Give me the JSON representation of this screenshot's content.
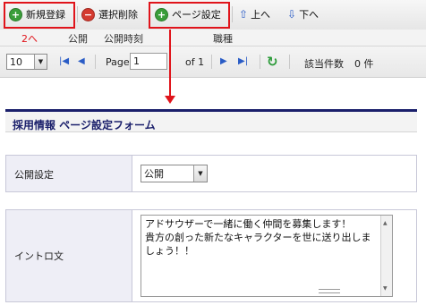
{
  "toolbar": {
    "new_label": "新規登録",
    "delete_label": "選択削除",
    "page_settings_label": "ページ設定",
    "up_label": "上へ",
    "down_label": "下へ"
  },
  "columns": {
    "annotation": "2へ",
    "public": "公開",
    "publish_time": "公開時刻",
    "job_type": "職種"
  },
  "pager": {
    "page_size": "10",
    "page_label": "Page",
    "page_value": "1",
    "of_label": "of 1",
    "count_label": "該当件数",
    "count_value": "0 件"
  },
  "form": {
    "title": "採用情報  ページ設定フォーム",
    "publish_setting_label": "公開設定",
    "publish_setting_value": "公開",
    "intro_label": "イントロ文",
    "intro_text": "アドサウザーで一緒に働く仲間を募集します！\n貴方の創った新たなキャラクターを世に送り出しましょう！！"
  },
  "colors": {
    "highlight": "#e0141b",
    "title_bar": "#1a1f6b"
  }
}
